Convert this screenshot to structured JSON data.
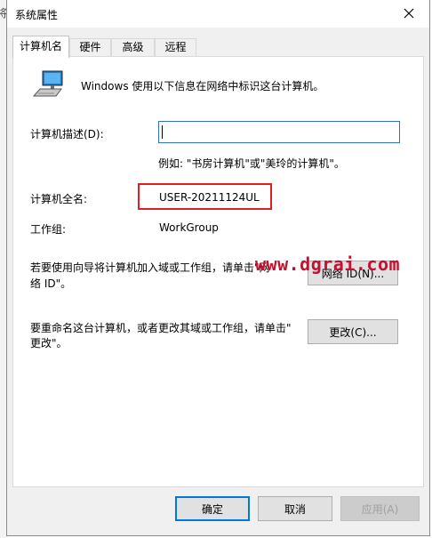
{
  "background": {
    "edge_text": "将"
  },
  "window": {
    "title": "系统属性"
  },
  "tabs": [
    {
      "label": "计算机名",
      "active": true
    },
    {
      "label": "硬件",
      "active": false
    },
    {
      "label": "高级",
      "active": false
    },
    {
      "label": "远程",
      "active": false
    }
  ],
  "computer_name_tab": {
    "intro": "Windows 使用以下信息在网络中标识这台计算机。",
    "description_label": "计算机描述(D):",
    "description_value": "",
    "example": "例如: \"书房计算机\"或\"美玲的计算机\"。",
    "fullname_label": "计算机全名:",
    "fullname_value": "USER-20211124UL",
    "workgroup_label": "工作组:",
    "workgroup_value": "WorkGroup",
    "network_id_text_line1": "若要使用向导将计算机加入域或工作组，请单击\"网",
    "network_id_text_line2": "络 ID\"。",
    "network_id_button": "网络 ID(N)...",
    "rename_text_line1": "要重命名这台计算机，或者更改其域或工作组，请单击\"",
    "rename_text_line2": "更改\"。",
    "change_button": "更改(C)..."
  },
  "footer": {
    "ok": "确定",
    "cancel": "取消",
    "apply": "应用(A)"
  },
  "watermark": "www.dgrai.com",
  "colors": {
    "highlight_border": "#e02020",
    "primary_border": "#0078d7",
    "watermark": "#c8102e"
  }
}
